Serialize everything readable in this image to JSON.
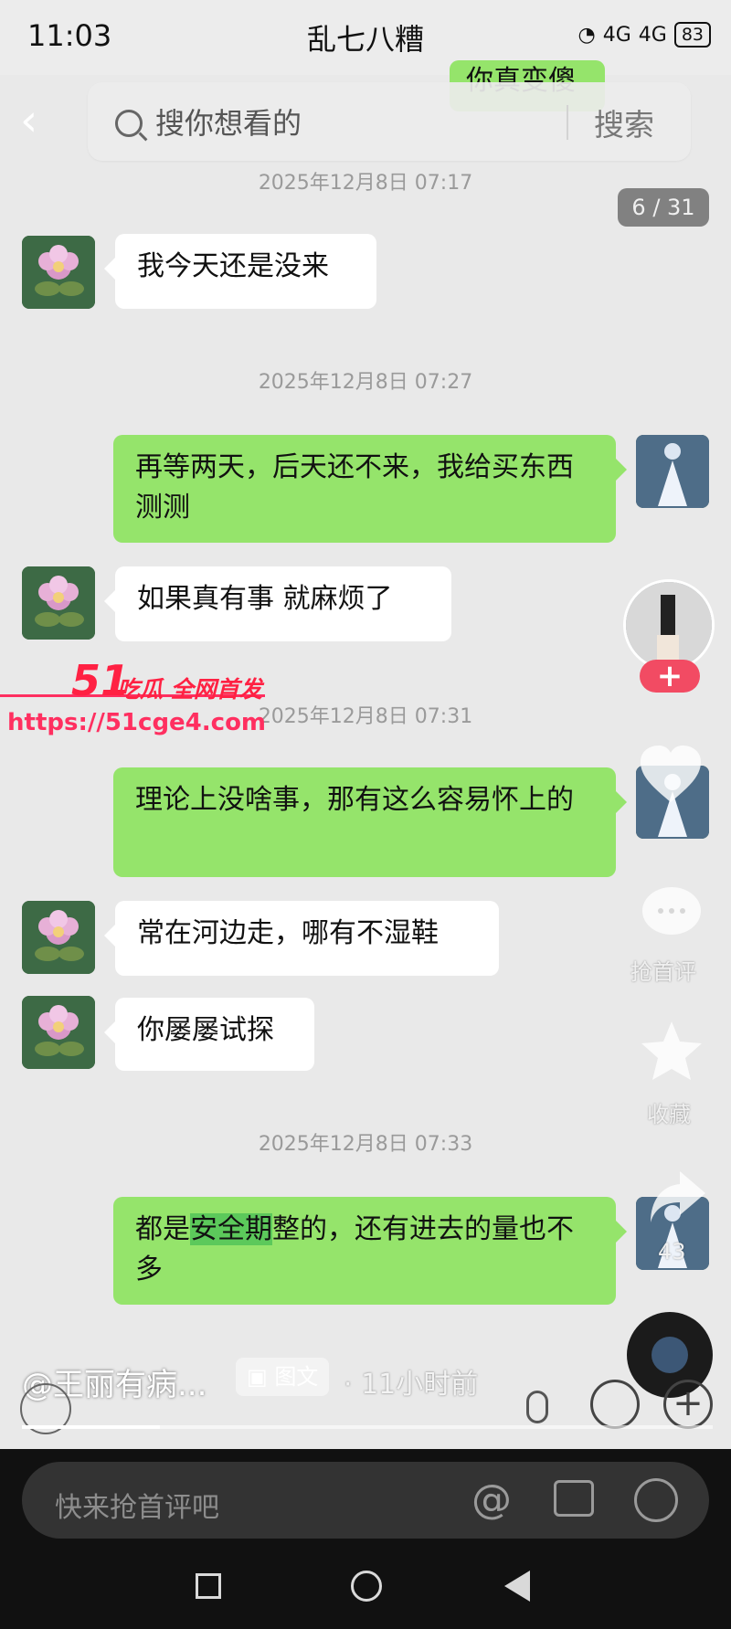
{
  "status_bar": {
    "time": "11:03",
    "title": "乱七八糟",
    "signal_1": "4G",
    "signal_2": "4G",
    "battery": "83"
  },
  "search": {
    "placeholder": "搜你想看的",
    "button": "搜索"
  },
  "counter": "6 / 31",
  "messages": [
    {
      "type": "time",
      "text": "2025年12月8日 07:17"
    },
    {
      "type": "left",
      "text": "我今天还是没来"
    },
    {
      "type": "time",
      "text": "2025年12月8日 07:27"
    },
    {
      "type": "right",
      "text": "再等两天，后天还不来，我给买东西测测"
    },
    {
      "type": "left",
      "text": "如果真有事  就麻烦了"
    },
    {
      "type": "time",
      "text": "2025年12月8日 07:31"
    },
    {
      "type": "right",
      "text": "理论上没啥事，那有这么容易怀上的"
    },
    {
      "type": "left",
      "text": "常在河边走，哪有不湿鞋"
    },
    {
      "type": "left",
      "text": "你屡屡试探"
    },
    {
      "type": "time",
      "text": "2025年12月8日 07:33"
    },
    {
      "type": "right",
      "text_before": "都是",
      "highlight": "安全期",
      "text_after": "整的，还有进去的量也不多"
    }
  ],
  "partial_top_message": "你真变傻",
  "watermark": {
    "brand_51": "51",
    "brand_text": "吃瓜 全网首发",
    "url": "https://51cge4.com"
  },
  "sidebar": {
    "comment_label": "抢首评",
    "favorite_label": "收藏",
    "share_count": "43"
  },
  "post": {
    "author": "@王丽有病...",
    "type_badge": "图文",
    "time": "· 11小时前",
    "progress": 0.2
  },
  "comment_bar": {
    "placeholder": "快来抢首评吧"
  },
  "icons": [
    "back-icon",
    "search-icon",
    "heart-icon",
    "comment-icon",
    "star-icon",
    "share-icon",
    "music-disc-icon",
    "audio-icon",
    "mic-icon",
    "emoji-icon",
    "plus-icon",
    "at-icon",
    "image-icon",
    "smile-icon",
    "nav-recent-icon",
    "nav-home-icon",
    "nav-back-icon"
  ],
  "colors": {
    "bubble_right": "#95e46b",
    "bubble_left": "#ffffff",
    "highlight": "#5cc95b",
    "follow": "#f24b63",
    "watermark": "#ff2143"
  }
}
